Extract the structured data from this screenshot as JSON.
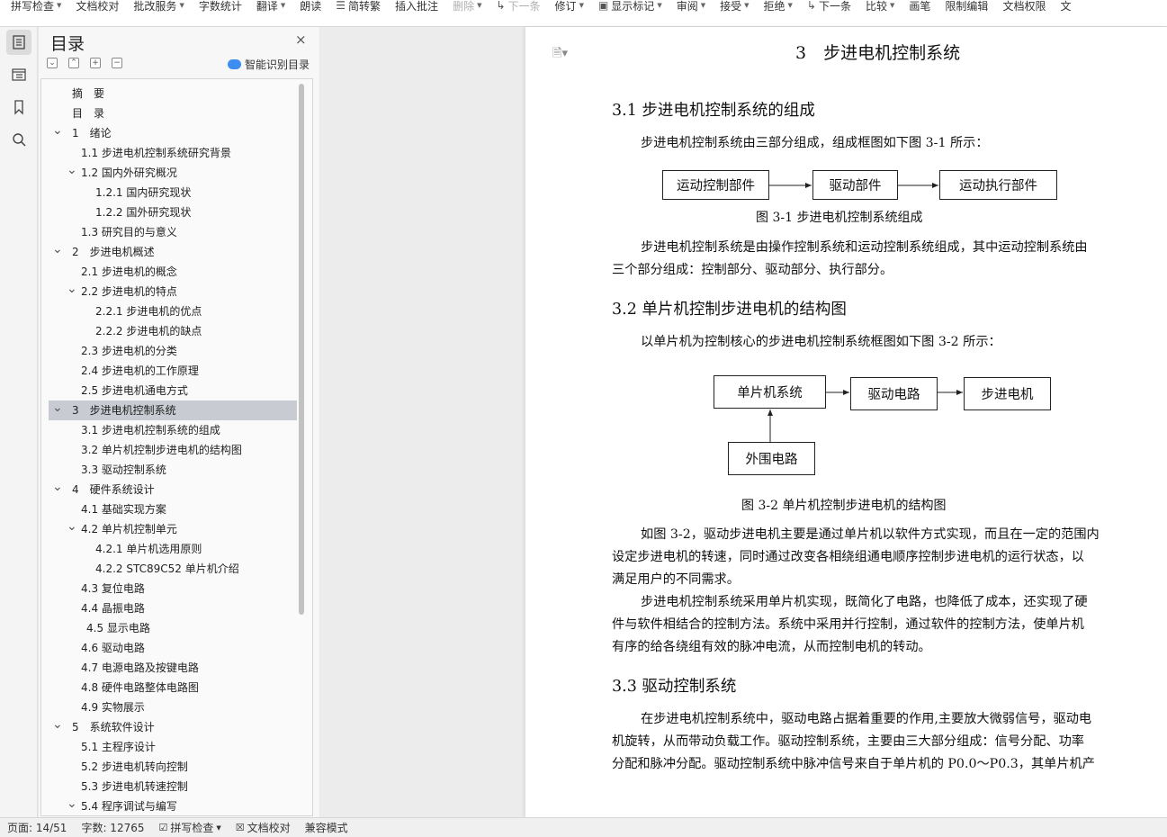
{
  "toolbar": {
    "items": [
      {
        "label": "拼写检查",
        "caret": true,
        "disabled": false
      },
      {
        "label": "文档校对",
        "caret": false,
        "disabled": false
      },
      {
        "label": "批改服务",
        "caret": true,
        "disabled": false
      },
      {
        "label": "字数统计",
        "caret": false,
        "disabled": false
      },
      {
        "label": "翻译",
        "caret": true,
        "disabled": false
      },
      {
        "label": "朗读",
        "caret": false,
        "disabled": false
      },
      {
        "label": "简转繁",
        "caret": false,
        "disabled": false
      },
      {
        "label": "插入批注",
        "caret": false,
        "disabled": false
      },
      {
        "label": "删除",
        "caret": true,
        "disabled": true
      },
      {
        "label": "下一条",
        "caret": false,
        "disabled": true
      },
      {
        "label": "修订",
        "caret": true,
        "disabled": false
      },
      {
        "label": "显示标记",
        "caret": true,
        "disabled": false
      },
      {
        "label": "审阅",
        "caret": true,
        "disabled": false
      },
      {
        "label": "接受",
        "caret": true,
        "disabled": false
      },
      {
        "label": "拒绝",
        "caret": true,
        "disabled": false
      },
      {
        "label": "下一条",
        "caret": false,
        "disabled": false
      },
      {
        "label": "比较",
        "caret": true,
        "disabled": false
      },
      {
        "label": "画笔",
        "caret": false,
        "disabled": false
      },
      {
        "label": "限制编辑",
        "caret": false,
        "disabled": false
      },
      {
        "label": "文档权限",
        "caret": false,
        "disabled": false
      },
      {
        "label": "文",
        "caret": false,
        "disabled": false
      }
    ]
  },
  "toc": {
    "title": "目录",
    "close": "×",
    "smart_label": "智能识别目录",
    "controls": [
      "⌄",
      "⌃",
      "+",
      "−"
    ],
    "items": [
      {
        "label": "摘　要",
        "level": 0,
        "chevron": false,
        "selected": false
      },
      {
        "label": "目　录",
        "level": 0,
        "chevron": false,
        "selected": false
      },
      {
        "label": "1　绪论",
        "level": 0,
        "chevron": true,
        "selected": false
      },
      {
        "label": "1.1  步进电机控制系统研究背景",
        "level": 1,
        "chevron": false,
        "selected": false
      },
      {
        "label": "1.2  国内外研究概况",
        "level": 1,
        "chevron": true,
        "selected": false
      },
      {
        "label": "1.2.1  国内研究现状",
        "level": 2,
        "chevron": false,
        "selected": false
      },
      {
        "label": "1.2.2  国外研究现状",
        "level": 2,
        "chevron": false,
        "selected": false
      },
      {
        "label": "1.3  研究目的与意义",
        "level": 1,
        "chevron": false,
        "selected": false
      },
      {
        "label": "2　步进电机概述",
        "level": 0,
        "chevron": true,
        "selected": false
      },
      {
        "label": "2.1  步进电机的概念",
        "level": 1,
        "chevron": false,
        "selected": false
      },
      {
        "label": "2.2  步进电机的特点",
        "level": 1,
        "chevron": true,
        "selected": false
      },
      {
        "label": "2.2.1  步进电机的优点",
        "level": 2,
        "chevron": false,
        "selected": false
      },
      {
        "label": "2.2.2  步进电机的缺点",
        "level": 2,
        "chevron": false,
        "selected": false
      },
      {
        "label": "2.3  步进电机的分类",
        "level": 1,
        "chevron": false,
        "selected": false
      },
      {
        "label": "2.4  步进电机的工作原理",
        "level": 1,
        "chevron": false,
        "selected": false
      },
      {
        "label": "2.5  步进电机通电方式",
        "level": 1,
        "chevron": false,
        "selected": false
      },
      {
        "label": "3　步进电机控制系统",
        "level": 0,
        "chevron": true,
        "selected": true
      },
      {
        "label": "3.1  步进电机控制系统的组成",
        "level": 1,
        "chevron": false,
        "selected": false
      },
      {
        "label": "3.2 单片机控制步进电机的结构图",
        "level": 1,
        "chevron": false,
        "selected": false
      },
      {
        "label": "3.3  驱动控制系统",
        "level": 1,
        "chevron": false,
        "selected": false
      },
      {
        "label": "4　硬件系统设计",
        "level": 0,
        "chevron": true,
        "selected": false
      },
      {
        "label": "4.1  基础实现方案",
        "level": 1,
        "chevron": false,
        "selected": false
      },
      {
        "label": "4.2  单片机控制单元",
        "level": 1,
        "chevron": true,
        "selected": false
      },
      {
        "label": "4.2.1  单片机选用原则",
        "level": 2,
        "chevron": false,
        "selected": false
      },
      {
        "label": "4.2.2 STC89C52 单片机介绍",
        "level": 2,
        "chevron": false,
        "selected": false
      },
      {
        "label": "4.3  复位电路",
        "level": 1,
        "chevron": false,
        "selected": false
      },
      {
        "label": "4.4  晶振电路",
        "level": 1,
        "chevron": false,
        "selected": false
      },
      {
        "label": "4.5  显示电路",
        "level": 1.4,
        "chevron": false,
        "selected": false
      },
      {
        "label": "4.6  驱动电路",
        "level": 1,
        "chevron": false,
        "selected": false
      },
      {
        "label": "4.7  电源电路及按键电路",
        "level": 1,
        "chevron": false,
        "selected": false
      },
      {
        "label": "4.8  硬件电路整体电路图",
        "level": 1,
        "chevron": false,
        "selected": false
      },
      {
        "label": "4.9  实物展示",
        "level": 1,
        "chevron": false,
        "selected": false
      },
      {
        "label": "5　系统软件设计",
        "level": 0,
        "chevron": true,
        "selected": false
      },
      {
        "label": "5.1  主程序设计",
        "level": 1,
        "chevron": false,
        "selected": false
      },
      {
        "label": "5.2  步进电机转向控制",
        "level": 1,
        "chevron": false,
        "selected": false
      },
      {
        "label": "5.3  步进电机转速控制",
        "level": 1,
        "chevron": false,
        "selected": false
      },
      {
        "label": "5.4  程序调试与编写",
        "level": 1,
        "chevron": true,
        "selected": false
      }
    ]
  },
  "doc": {
    "chapter_title": "3　步进电机控制系统",
    "s31_title": "3.1  步进电机控制系统的组成",
    "s31_p1": "步进电机控制系统由三部分组成，组成框图如下图 3-1 所示：",
    "fig31": {
      "boxes": [
        "运动控制部件",
        "驱动部件",
        "运动执行部件"
      ],
      "caption": "图 3-1  步进电机控制系统组成"
    },
    "s31_p2_l1": "步进电机控制系统是由操作控制系统和运动控制系统组成，其中运动控制系统由",
    "s31_p2_l2": "三个部分组成：控制部分、驱动部分、执行部分。",
    "s32_title": "3.2 单片机控制步进电机的结构图",
    "s32_p1": "以单片机为控制核心的步进电机控制系统框图如下图 3-2 所示：",
    "fig32": {
      "boxes": [
        "单片机系统",
        "驱动电路",
        "步进电机",
        "外围电路"
      ],
      "caption": "图 3-2  单片机控制步进电机的结构图"
    },
    "s32_p2_l1": "如图 3-2，驱动步进电机主要是通过单片机以软件方式实现，而且在一定的范围内",
    "s32_p2_l2": "设定步进电机的转速，同时通过改变各相绕组通电顺序控制步进电机的运行状态，以",
    "s32_p2_l3": "满足用户的不同需求。",
    "s32_p3_l1": "步进电机控制系统采用单片机实现，既简化了电路，也降低了成本，还实现了硬",
    "s32_p3_l2": "件与软件相结合的控制方法。系统中采用并行控制，通过软件的控制方法，使单片机",
    "s32_p3_l3": "有序的给各绕组有效的脉冲电流，从而控制电机的转动。",
    "s33_title": "3.3  驱动控制系统",
    "s33_p1_l1": "在步进电机控制系统中，驱动电路占据着重要的作用,主要放大微弱信号，驱动电",
    "s33_p1_l2": "机旋转，从而带动负载工作。驱动控制系统，主要由三大部分组成：信号分配、功率",
    "s33_p1_l3": "分配和脉冲分配。驱动控制系统中脉冲信号来自于单片机的 P0.0～P0.3，其单片机产"
  },
  "status": {
    "page": "页面: 14/51",
    "words": "字数: 12765",
    "spell": "拼写检查",
    "proof": "文档校对",
    "compat": "兼容模式"
  }
}
